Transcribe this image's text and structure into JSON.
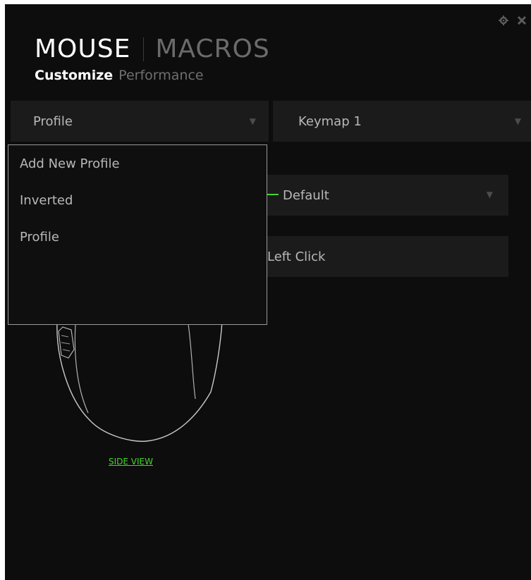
{
  "window_controls": {
    "settings_icon": "gear-icon",
    "close_icon": "close-icon"
  },
  "header": {
    "active_tab": "MOUSE",
    "inactive_tab": "MACROS",
    "subtabs": [
      "Customize",
      "Performance"
    ]
  },
  "profile_select": {
    "value": "Profile"
  },
  "keymap_select": {
    "value": "Keymap 1"
  },
  "profile_dropdown": {
    "items": [
      "Add New Profile",
      "Inverted",
      "Profile"
    ]
  },
  "button_config": {
    "mode_value": "Default",
    "action_value": "Left Click"
  },
  "mouse_view": {
    "side_view_link": "SIDE VIEW"
  },
  "colors": {
    "background": "#0d0d0d",
    "accent_green": "#44d62c",
    "text_white": "#ffffff",
    "text_gray": "#b8b8b8"
  }
}
